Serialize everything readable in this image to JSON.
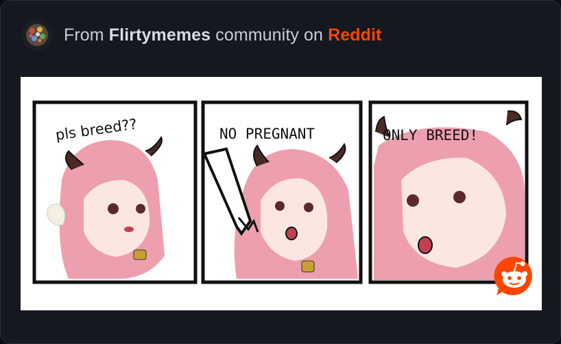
{
  "post": {
    "prefix": "From",
    "community": "Flirtymemes",
    "middle": "community on",
    "platform": "Reddit"
  },
  "comic": {
    "panel1_caption": "pls breed??",
    "panel2_caption": "NO PREGNANT",
    "panel3_caption": "ONLY BREED!"
  },
  "colors": {
    "card_bg": "#15181f",
    "reddit_orange": "#ff4500",
    "hair_pink": "#ee9fae"
  },
  "icons": {
    "avatar": "community-avatar-icon",
    "watermark": "reddit-logo-icon"
  }
}
